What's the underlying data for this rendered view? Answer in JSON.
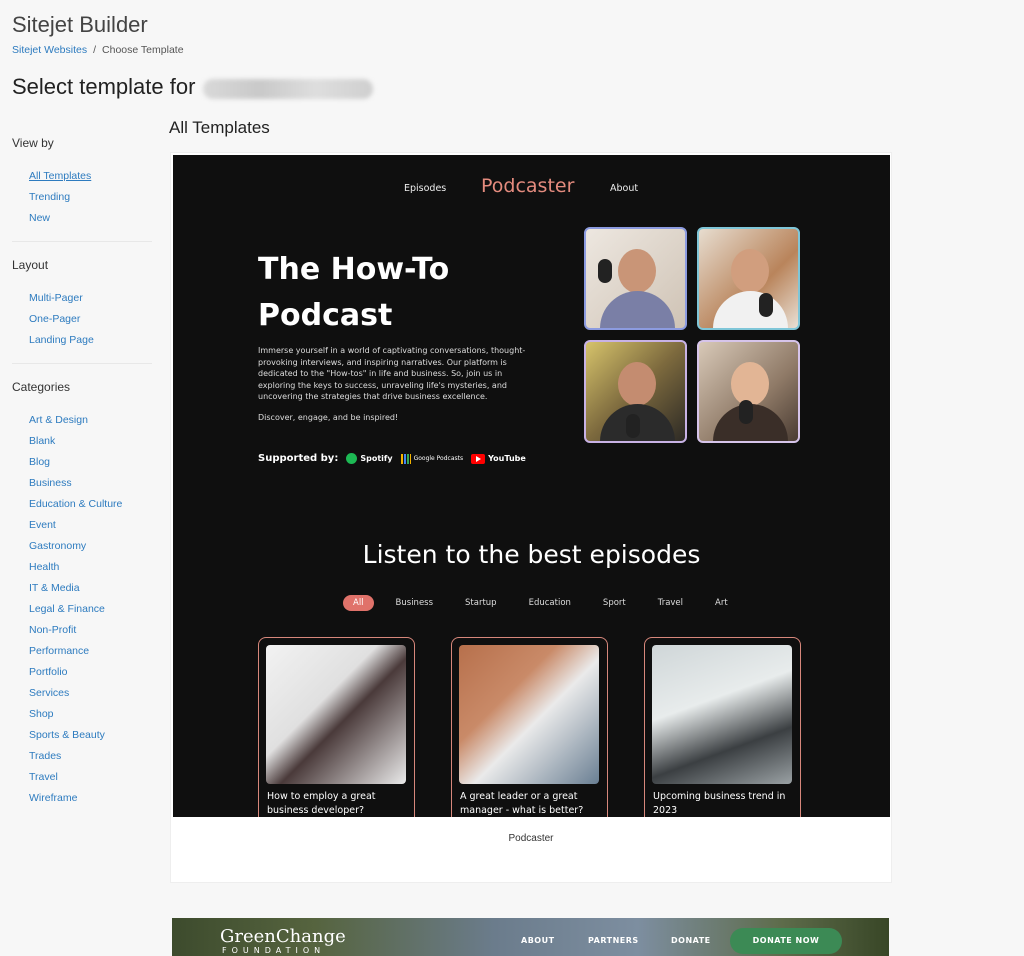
{
  "app": {
    "title": "Sitejet Builder",
    "breadcrumb": {
      "parent": "Sitejet Websites",
      "separator": "/",
      "current": "Choose Template"
    },
    "page_title_prefix": "Select template for"
  },
  "sidebar": {
    "view_by": {
      "heading": "View by",
      "items": [
        "All Templates",
        "Trending",
        "New"
      ],
      "active": "All Templates"
    },
    "layout": {
      "heading": "Layout",
      "items": [
        "Multi-Pager",
        "One-Pager",
        "Landing Page"
      ]
    },
    "categories": {
      "heading": "Categories",
      "items": [
        "Art & Design",
        "Blank",
        "Blog",
        "Business",
        "Education & Culture",
        "Event",
        "Gastronomy",
        "Health",
        "IT & Media",
        "Legal & Finance",
        "Non-Profit",
        "Performance",
        "Portfolio",
        "Services",
        "Shop",
        "Sports & Beauty",
        "Trades",
        "Travel",
        "Wireframe"
      ]
    }
  },
  "main": {
    "section_title": "All Templates",
    "templates": [
      {
        "name": "Podcaster",
        "preview": {
          "nav": {
            "left": "Episodes",
            "brand": "Podcaster",
            "right": "About"
          },
          "hero_title_line1": "The How-To",
          "hero_title_line2": "Podcast",
          "hero_description": "Immerse yourself in a world of captivating conversations, thought-provoking interviews, and inspiring narratives. Our platform is dedicated to the \"How-tos\" in life and business. So, join us in exploring the keys to success, unraveling life's mysteries, and uncovering the strategies that drive business excellence.",
          "hero_cta": "Discover, engage, and be inspired!",
          "supported_by": "Supported by:",
          "partners": [
            "Spotify",
            "Google Podcasts",
            "YouTube"
          ],
          "episodes_title": "Listen to the best episodes",
          "filters": [
            "All",
            "Business",
            "Startup",
            "Education",
            "Sport",
            "Travel",
            "Art"
          ],
          "active_filter": "All",
          "episodes": [
            "How to employ a great business developer?",
            "A great leader or a great manager - what is better?",
            "Upcoming business trend in 2023"
          ]
        }
      },
      {
        "name": "GreenChange Foundation",
        "preview": {
          "logo": "GreenChange",
          "logo_sub": "FOUNDATION",
          "nav": [
            "ABOUT",
            "PARTNERS",
            "DONATE"
          ],
          "cta": "DONATE NOW"
        }
      }
    ]
  },
  "colors": {
    "link": "#2d7bbf",
    "preview_bg": "#0f0f0f",
    "brand_accent": "#e48b7e",
    "filter_active": "#e0726a",
    "donate_green": "#3c8a55"
  }
}
